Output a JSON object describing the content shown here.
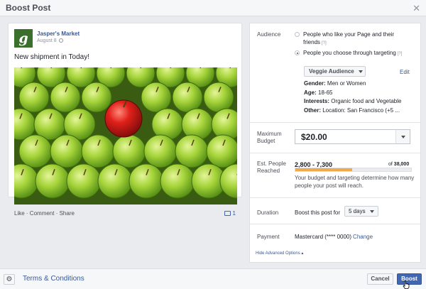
{
  "dialog": {
    "title": "Boost Post",
    "close_icon": "close-icon"
  },
  "post": {
    "page_name": "Jasper's Market",
    "logo_letter": "g",
    "date": "August 8",
    "text": "New shipment in Today!",
    "image_description_icon": "apples-photo",
    "actions": [
      "Like",
      "Comment",
      "Share"
    ],
    "comment_count": "1"
  },
  "panel": {
    "audience": {
      "label": "Audience",
      "options": [
        {
          "label": "People who like your Page and their friends",
          "help": "[?]",
          "selected": false
        },
        {
          "label": "People you choose through targeting",
          "help": "[?]",
          "selected": true
        }
      ],
      "selected_audience": "Veggie Audience",
      "edit_label": "Edit",
      "details": [
        {
          "key": "Gender:",
          "value": "Men or Women"
        },
        {
          "key": "Age:",
          "value": "18-65"
        },
        {
          "key": "Interests:",
          "value": "Organic food and Vegetable"
        },
        {
          "key": "Other:",
          "value": "Location: San Francisco (+5 ..."
        }
      ]
    },
    "budget": {
      "label_line1": "Maximum",
      "label_line2": "Budget",
      "value": "$20.00"
    },
    "reach": {
      "label_line1": "Est. People",
      "label_line2": "Reached",
      "range": "2,800 - 7,300",
      "total_prefix": "of",
      "total": "38,000",
      "fill_fraction": 0.49,
      "note": "Your budget and targeting determine how many people your post will reach."
    },
    "duration": {
      "label": "Duration",
      "text": "Boost this post for",
      "value": "5 days"
    },
    "payment": {
      "label": "Payment",
      "method": "Mastercard (**** 0000)",
      "change_label": "Change"
    },
    "hide_advanced": "Hide Advanced Options ▴"
  },
  "footer": {
    "settings_icon": "gear-icon",
    "terms": "Terms & Conditions",
    "cancel": "Cancel",
    "boost": "Boost"
  },
  "colors": {
    "accent": "#4267b2",
    "link": "#365899",
    "reach_bar": "#f0a94b",
    "logo_green": "#3b6f2c"
  }
}
